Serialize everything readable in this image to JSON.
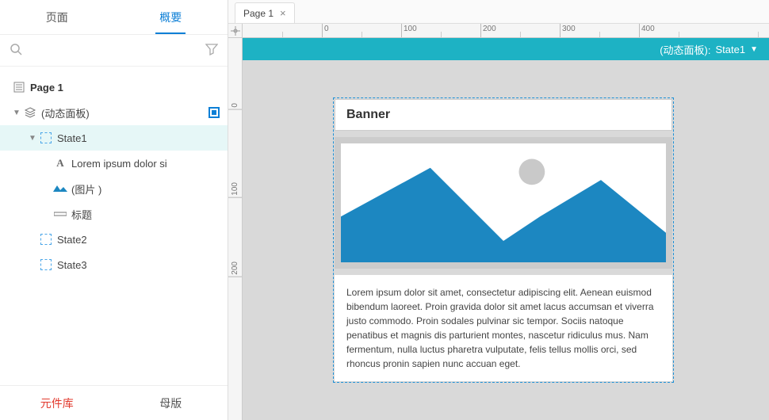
{
  "sidebar": {
    "tabs": {
      "pages": "页面",
      "outline": "概要"
    },
    "search_placeholder": "",
    "page_label": "Page 1",
    "dynamic_panel_label": "(动态面板)",
    "state1_label": "State1",
    "text_widget_label": "Lorem ipsum dolor si",
    "image_widget_label": "(图片 )",
    "title_widget_label": "标题",
    "state2_label": "State2",
    "state3_label": "State3",
    "bottom_tabs": {
      "widgets": "元件库",
      "masters": "母版"
    }
  },
  "tabbar": {
    "page": "Page 1"
  },
  "ruler": {
    "h_ticks": [
      "0",
      "100",
      "200",
      "300",
      "400"
    ],
    "v_ticks": [
      "0",
      "100",
      "200"
    ]
  },
  "state_header": {
    "prefix": "(动态面板):",
    "state": "State1"
  },
  "canvas": {
    "banner_title": "Banner",
    "body_text": "Lorem ipsum dolor sit amet, consectetur adipiscing elit. Aenean euismod bibendum laoreet. Proin gravida dolor sit amet lacus accumsan et viverra justo commodo. Proin sodales pulvinar sic tempor. Sociis natoque penatibus et magnis dis parturient montes, nascetur ridiculus mus. Nam fermentum, nulla luctus pharetra vulputate, felis tellus mollis orci, sed rhoncus pronin sapien nunc accuan eget."
  },
  "colors": {
    "accent": "#1db2c4",
    "link": "#0d7fd6",
    "red": "#e23a2e",
    "blue_shape": "#1c87c1"
  }
}
